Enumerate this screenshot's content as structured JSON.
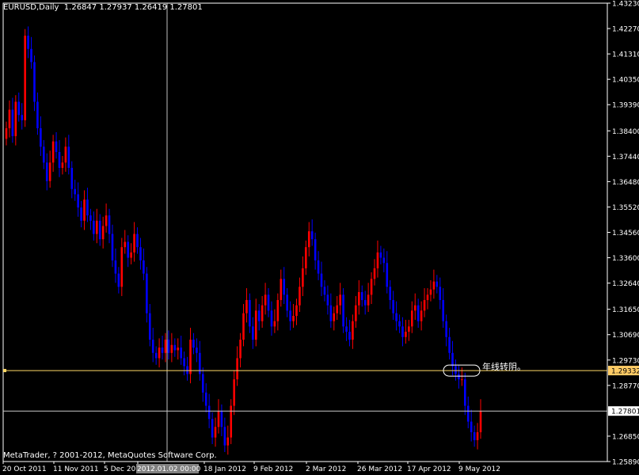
{
  "header": {
    "symbol": "EURUSD,Daily",
    "ohlc": "1.26847 1.27937 1.26419 1.27801"
  },
  "copyright": "MetaTrader, ? 2001-2012, MetaQuotes Software Corp.",
  "annotation": "年线转阴。",
  "colors": {
    "background": "#000000",
    "up_candle": "#ff0000",
    "down_candle": "#0000ff",
    "axis": "#ffffff",
    "hline": "#ffd966",
    "price_marker_bg": "#ffcc66",
    "current_marker_bg": "#ffffff"
  },
  "chart_data": {
    "type": "candlestick",
    "y_ticks": [
      "1.43230",
      "1.42270",
      "1.41310",
      "1.40350",
      "1.39390",
      "1.38400",
      "1.37440",
      "1.36480",
      "1.35520",
      "1.34560",
      "1.33600",
      "1.32640",
      "1.31650",
      "1.30690",
      "1.29730",
      "1.28770",
      "1.26850",
      "1.25890"
    ],
    "y_range": [
      1.2589,
      1.4323
    ],
    "x_ticks": [
      "20 Oct 2011",
      "11 Nov 2011",
      "5 Dec 2011",
      "2012.01.02 00:00",
      "18 Jan 2012",
      "9 Feb 2012",
      "2 Mar 2012",
      "26 Mar 2012",
      "17 Apr 2012",
      "9 May 2012"
    ],
    "horizontal_line_label": "1.29332",
    "current_price_label": "1.27801",
    "horizontal_line_value": 1.29332,
    "current_price_value": 1.27801,
    "closes": [
      1.385,
      1.392,
      1.382,
      1.395,
      1.39,
      1.388,
      1.42,
      1.415,
      1.41,
      1.395,
      1.385,
      1.378,
      1.372,
      1.365,
      1.372,
      1.38,
      1.376,
      1.37,
      1.372,
      1.378,
      1.37,
      1.362,
      1.36,
      1.355,
      1.35,
      1.358,
      1.352,
      1.35,
      1.345,
      1.35,
      1.343,
      1.348,
      1.352,
      1.345,
      1.335,
      1.33,
      1.325,
      1.34,
      1.342,
      1.336,
      1.338,
      1.345,
      1.34,
      1.335,
      1.33,
      1.315,
      1.305,
      1.3,
      1.298,
      1.302,
      1.3,
      1.305,
      1.3,
      1.303,
      1.301,
      1.302,
      1.298,
      1.295,
      1.292,
      1.305,
      1.302,
      1.3,
      1.292,
      1.285,
      1.28,
      1.275,
      1.268,
      1.272,
      1.278,
      1.272,
      1.265,
      1.268,
      1.28,
      1.29,
      1.298,
      1.305,
      1.315,
      1.32,
      1.31,
      1.305,
      1.316,
      1.312,
      1.318,
      1.322,
      1.316,
      1.31,
      1.312,
      1.32,
      1.328,
      1.322,
      1.316,
      1.312,
      1.314,
      1.318,
      1.325,
      1.332,
      1.34,
      1.346,
      1.343,
      1.335,
      1.33,
      1.325,
      1.322,
      1.318,
      1.312,
      1.315,
      1.318,
      1.322,
      1.31,
      1.308,
      1.305,
      1.312,
      1.318,
      1.323,
      1.32,
      1.318,
      1.322,
      1.328,
      1.332,
      1.338,
      1.336,
      1.334,
      1.325,
      1.32,
      1.315,
      1.312,
      1.31,
      1.306,
      1.308,
      1.31,
      1.316,
      1.318,
      1.312,
      1.316,
      1.32,
      1.322,
      1.324,
      1.327,
      1.325,
      1.32,
      1.312,
      1.306,
      1.3,
      1.295,
      1.292,
      1.29,
      1.29,
      1.28,
      1.274,
      1.27,
      1.267,
      1.27,
      1.278
    ]
  }
}
